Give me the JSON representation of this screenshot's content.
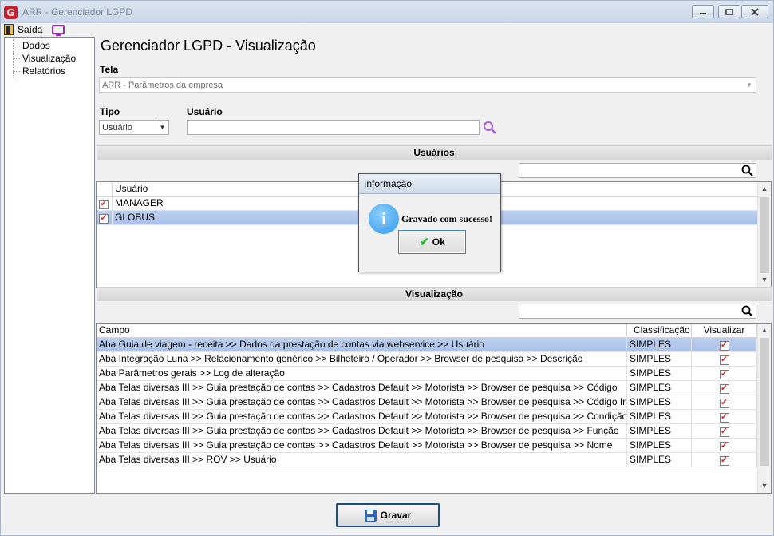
{
  "window": {
    "title": "ARR - Gerenciador LGPD",
    "logo_letter": "G"
  },
  "menu": {
    "exit_label": "Saída"
  },
  "sidebar": {
    "items": [
      {
        "label": "Dados"
      },
      {
        "label": "Visualização"
      },
      {
        "label": "Relatórios"
      }
    ]
  },
  "main": {
    "title": "Gerenciador LGPD - Visualização",
    "tela_label": "Tela",
    "tela_value": "ARR - Parâmetros da empresa",
    "tipo_label": "Tipo",
    "tipo_value": "Usuário",
    "usuario_label": "Usuário",
    "usuario_value": ""
  },
  "users_section": {
    "title": "Usuários",
    "column_header": "Usuário",
    "rows": [
      {
        "name": "MANAGER",
        "checked": true
      },
      {
        "name": "GLOBUS",
        "checked": true
      }
    ]
  },
  "visualization_section": {
    "title": "Visualização",
    "columns": [
      "Campo",
      "Classificação",
      "Visualizar"
    ],
    "rows": [
      {
        "campo": "Aba Guia de viagem - receita >> Dados da prestação de contas via webservice >> Usuário",
        "classificacao": "SIMPLES",
        "visualizar": true
      },
      {
        "campo": "Aba Integração Luna >> Relacionamento genérico >> Bilheteiro / Operador >> Browser de pesquisa >> Descrição",
        "classificacao": "SIMPLES",
        "visualizar": true
      },
      {
        "campo": "Aba Parâmetros gerais >> Log de alteração",
        "classificacao": "SIMPLES",
        "visualizar": true
      },
      {
        "campo": "Aba Telas diversas III >> Guia prestação de contas >> Cadastros Default >> Motorista >> Browser de pesquisa >> Código",
        "classificacao": "SIMPLES",
        "visualizar": true
      },
      {
        "campo": "Aba Telas diversas III >> Guia prestação de contas >> Cadastros Default >> Motorista >> Browser de pesquisa >> Código Interno",
        "classificacao": "SIMPLES",
        "visualizar": true
      },
      {
        "campo": "Aba Telas diversas III >> Guia prestação de contas >> Cadastros Default >> Motorista >> Browser de pesquisa >> Condição",
        "classificacao": "SIMPLES",
        "visualizar": true
      },
      {
        "campo": "Aba Telas diversas III >> Guia prestação de contas >> Cadastros Default >> Motorista >> Browser de pesquisa >> Função",
        "classificacao": "SIMPLES",
        "visualizar": true
      },
      {
        "campo": "Aba Telas diversas III >> Guia prestação de contas >> Cadastros Default >> Motorista >> Browser de pesquisa >> Nome",
        "classificacao": "SIMPLES",
        "visualizar": true
      },
      {
        "campo": "Aba Telas diversas III >> ROV >> Usuário",
        "classificacao": "SIMPLES",
        "visualizar": true
      }
    ]
  },
  "dialog": {
    "title": "Informação",
    "message": "Gravado com sucesso!",
    "ok_label": "Ok",
    "icon_glyph": "i"
  },
  "footer": {
    "save_label": "Gravar"
  },
  "colors": {
    "selection": "#a9c0e8",
    "check": "#dd2222",
    "accent": "#1c4f86"
  }
}
